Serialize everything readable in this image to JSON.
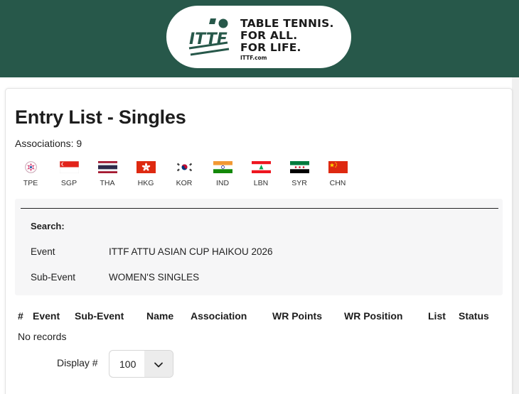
{
  "header": {
    "logo_lines": [
      "TABLE TENNIS.",
      "FOR ALL.",
      "FOR LIFE."
    ],
    "logo_url": "ITTF.com",
    "logo_mark_text": "ITTF"
  },
  "page": {
    "title": "Entry List - Singles",
    "associations_count": "Associations: 9"
  },
  "associations": [
    {
      "code": "TPE",
      "icon": "tpe-flag-icon"
    },
    {
      "code": "SGP",
      "icon": "sgp-flag-icon"
    },
    {
      "code": "THA",
      "icon": "tha-flag-icon"
    },
    {
      "code": "HKG",
      "icon": "hkg-flag-icon"
    },
    {
      "code": "KOR",
      "icon": "kor-flag-icon"
    },
    {
      "code": "IND",
      "icon": "ind-flag-icon"
    },
    {
      "code": "LBN",
      "icon": "lbn-flag-icon"
    },
    {
      "code": "SYR",
      "icon": "syr-flag-icon"
    },
    {
      "code": "CHN",
      "icon": "chn-flag-icon"
    }
  ],
  "search": {
    "heading": "Search:",
    "event_label": "Event",
    "event_value": "ITTF ATTU ASIAN CUP HAIKOU 2026",
    "subevent_label": "Sub-Event",
    "subevent_value": "WOMEN'S SINGLES"
  },
  "table": {
    "columns": [
      "#",
      "Event",
      "Sub-Event",
      "Name",
      "Association",
      "WR Points",
      "WR Position",
      "List",
      "Status"
    ],
    "empty_text": "No records"
  },
  "pagination": {
    "display_label": "Display #",
    "selected": "100",
    "icon": "chevron-down-icon"
  },
  "colors": {
    "banner": "#27584a",
    "search_bg": "#f6f6f7"
  }
}
